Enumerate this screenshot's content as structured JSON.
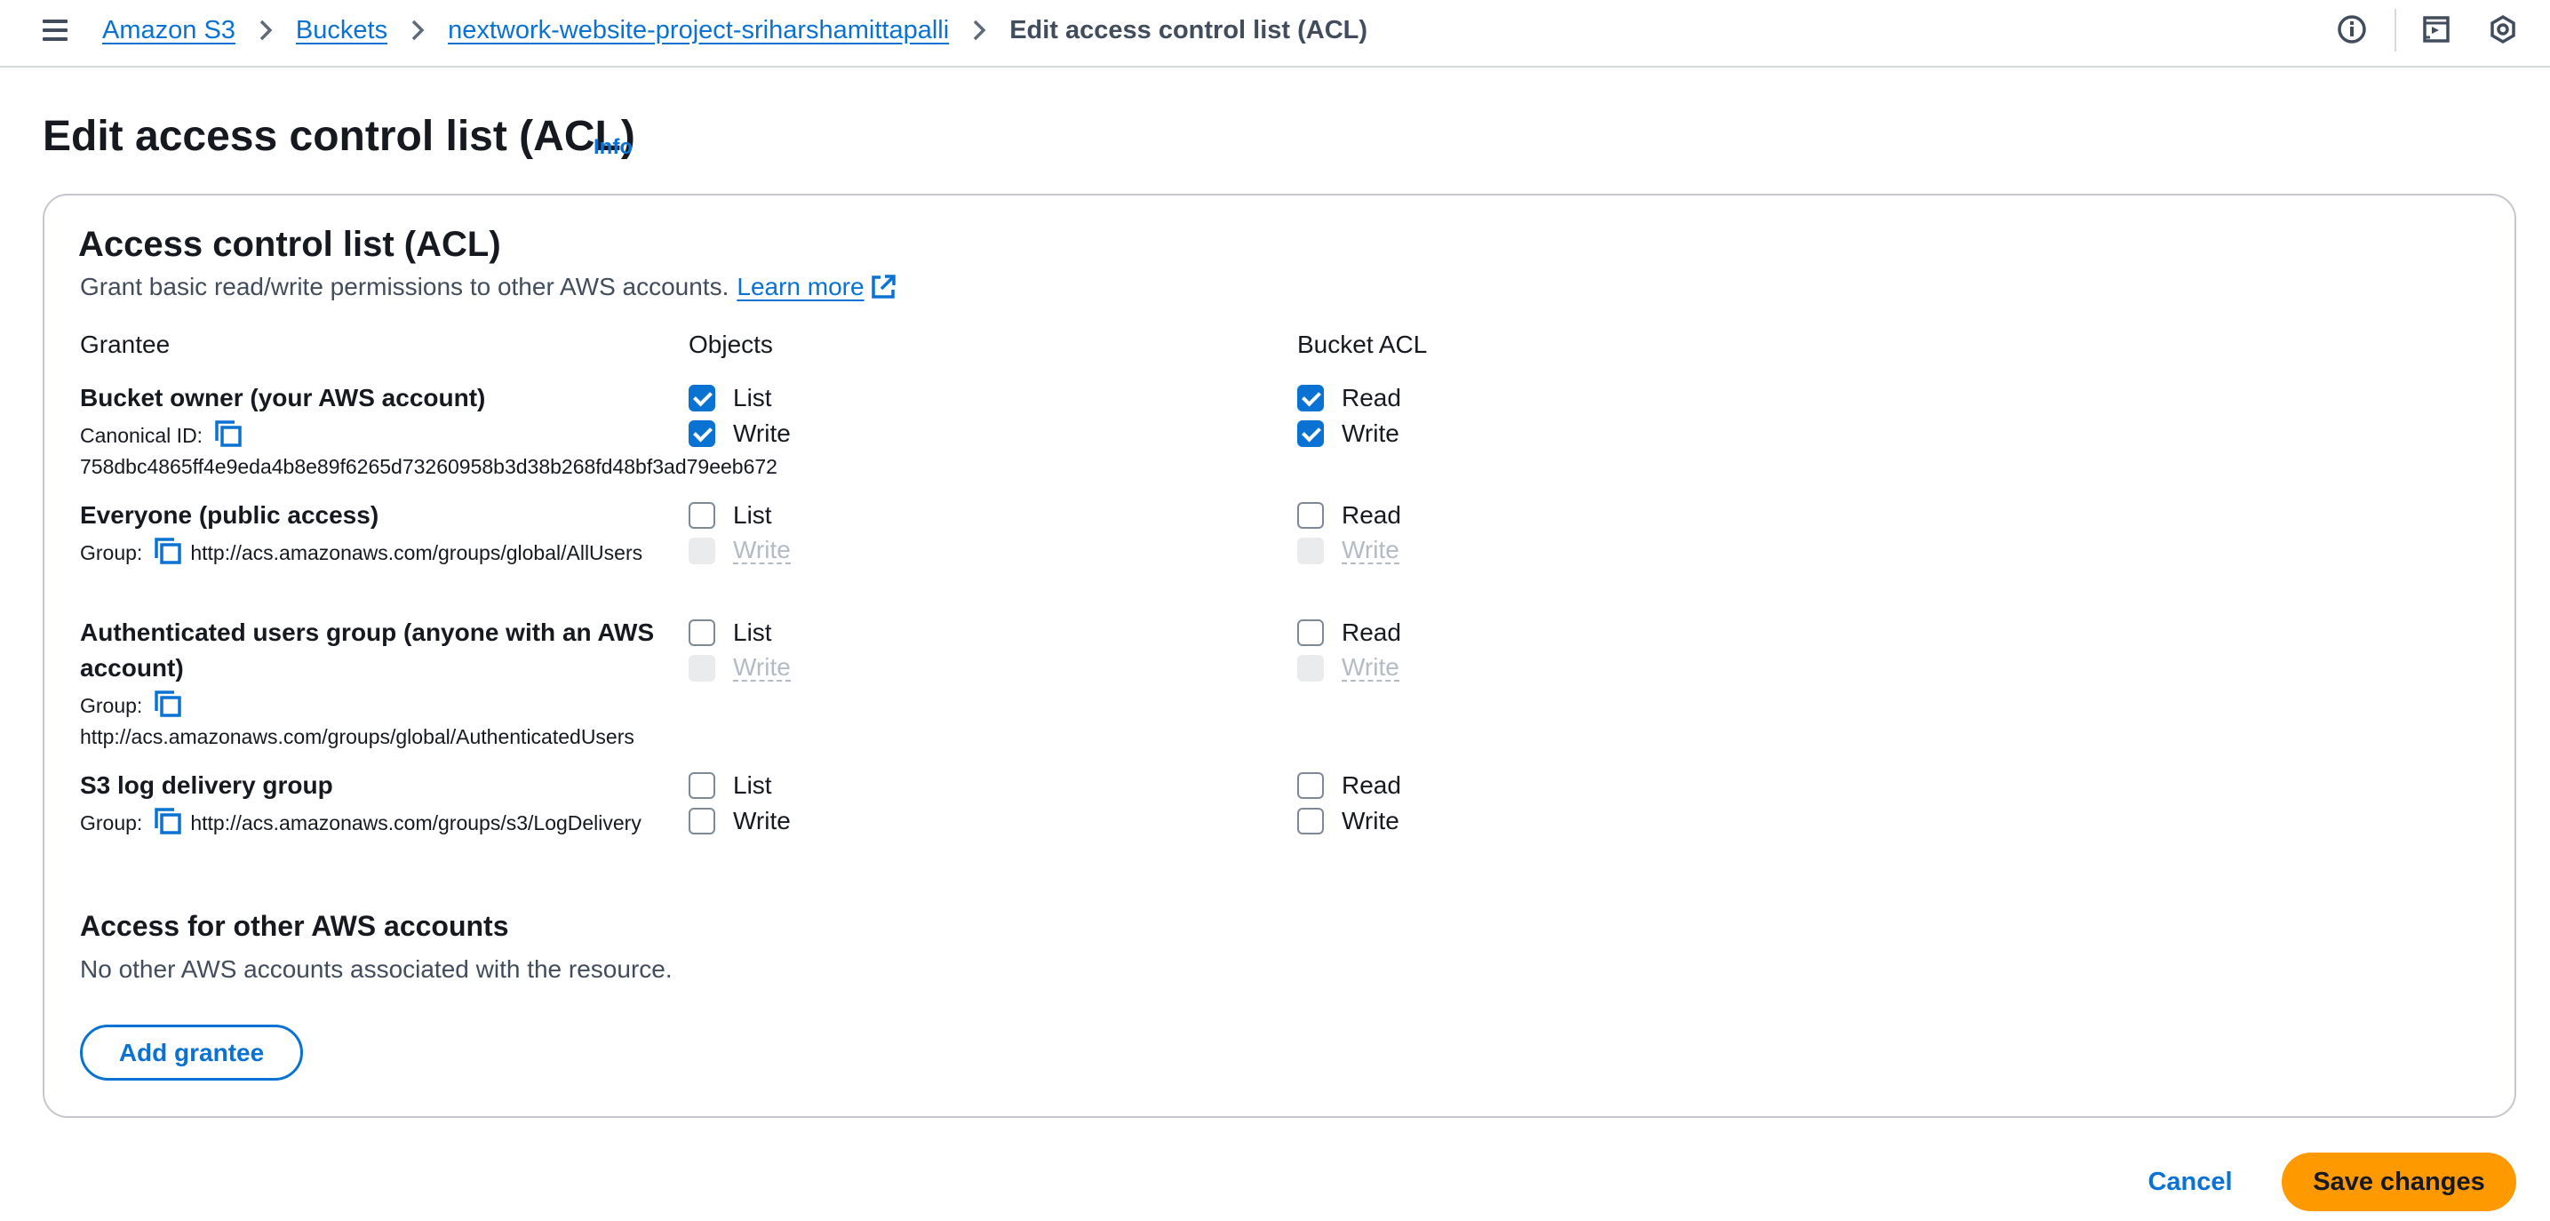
{
  "breadcrumb": {
    "items": [
      "Amazon S3",
      "Buckets",
      "nextwork-website-project-sriharshamittapalli"
    ],
    "current": "Edit access control list (ACL)"
  },
  "header_icons": [
    "info-circle-icon",
    "notifications-panel-icon",
    "settings-hexagon-icon"
  ],
  "page": {
    "title": "Edit access control list (ACL)",
    "info_label": "Info"
  },
  "acl": {
    "title": "Access control list (ACL)",
    "description": "Grant basic read/write permissions to other AWS accounts.",
    "learn_more": "Learn more",
    "columns": {
      "grantee": "Grantee",
      "objects": "Objects",
      "bucket_acl": "Bucket ACL"
    },
    "grantees": [
      {
        "name": "Bucket owner (your AWS account)",
        "id_label": "Canonical ID:",
        "id_value": "758dbc4865ff4e9eda4b8e89f6265d73260958b3d38b268fd48bf3ad79eeb672",
        "objects": [
          {
            "label": "List",
            "checked": true,
            "disabled": false
          },
          {
            "label": "Write",
            "checked": true,
            "disabled": false
          }
        ],
        "bucket_acl": [
          {
            "label": "Read",
            "checked": true,
            "disabled": false
          },
          {
            "label": "Write",
            "checked": true,
            "disabled": false
          }
        ]
      },
      {
        "name": "Everyone (public access)",
        "id_label": "Group:",
        "id_value": "http://acs.amazonaws.com/groups/global/AllUsers",
        "objects": [
          {
            "label": "List",
            "checked": false,
            "disabled": false
          },
          {
            "label": "Write",
            "checked": false,
            "disabled": true
          }
        ],
        "bucket_acl": [
          {
            "label": "Read",
            "checked": false,
            "disabled": false
          },
          {
            "label": "Write",
            "checked": false,
            "disabled": true
          }
        ]
      },
      {
        "name": "Authenticated users group (anyone with an AWS account)",
        "id_label": "Group:",
        "id_value": "http://acs.amazonaws.com/groups/global/AuthenticatedUsers",
        "objects": [
          {
            "label": "List",
            "checked": false,
            "disabled": false
          },
          {
            "label": "Write",
            "checked": false,
            "disabled": true
          }
        ],
        "bucket_acl": [
          {
            "label": "Read",
            "checked": false,
            "disabled": false
          },
          {
            "label": "Write",
            "checked": false,
            "disabled": true
          }
        ]
      },
      {
        "name": "S3 log delivery group",
        "id_label": "Group:",
        "id_value": "http://acs.amazonaws.com/groups/s3/LogDelivery",
        "objects": [
          {
            "label": "List",
            "checked": false,
            "disabled": false
          },
          {
            "label": "Write",
            "checked": false,
            "disabled": false
          }
        ],
        "bucket_acl": [
          {
            "label": "Read",
            "checked": false,
            "disabled": false
          },
          {
            "label": "Write",
            "checked": false,
            "disabled": false
          }
        ]
      }
    ]
  },
  "other_accounts": {
    "title": "Access for other AWS accounts",
    "description": "No other AWS accounts associated with the resource.",
    "add_button": "Add grantee"
  },
  "footer": {
    "cancel": "Cancel",
    "save": "Save changes"
  },
  "colors": {
    "link": "#0972d3",
    "primary_button": "#ff9900",
    "checkbox_checked": "#0972d3",
    "text": "#16191f",
    "muted_text": "#414d5c"
  }
}
